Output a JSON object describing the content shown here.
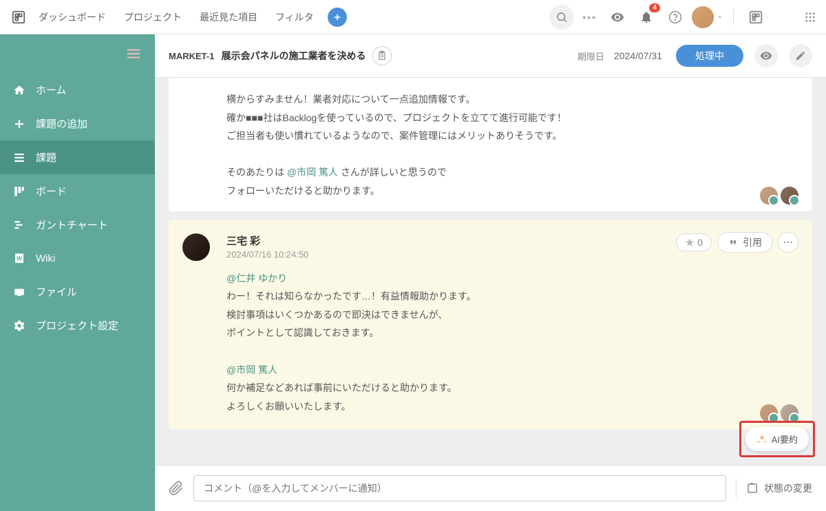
{
  "topnav": {
    "items": [
      "ダッシュボード",
      "プロジェクト",
      "最近見た項目",
      "フィルタ"
    ]
  },
  "notification_count": "4",
  "sidebar": {
    "items": [
      {
        "label": "ホーム"
      },
      {
        "label": "課題の追加"
      },
      {
        "label": "課題"
      },
      {
        "label": "ボード"
      },
      {
        "label": "ガントチャート"
      },
      {
        "label": "Wiki"
      },
      {
        "label": "ファイル"
      },
      {
        "label": "プロジェクト設定"
      }
    ]
  },
  "issue": {
    "key": "MARKET-1",
    "title": "展示会パネルの施工業者を決める",
    "due_label": "期限日",
    "due_date": "2024/07/31",
    "status": "処理中"
  },
  "comments": [
    {
      "line1": "横からすみません！業者対応について一点追加情報です。",
      "line2": "確か■■■社はBacklogを使っているので、プロジェクトを立てて進行可能です！",
      "line3": "ご担当者も使い慣れているようなので、案件管理にはメリットありそうです。",
      "line4a": "そのあたりは ",
      "mention1": "@市岡 篤人",
      "line4b": " さんが詳しいと思うので",
      "line5": "フォローいただけると助かります。"
    },
    {
      "author": "三宅 彩",
      "timestamp": "2024/07/16 10:24:50",
      "mention1": "@仁井 ゆかり",
      "line1": "わー！それは知らなかったです…！有益情報助かります。",
      "line2": "検討事項はいくつかあるので即決はできませんが、",
      "line3": "ポイントとして認識しておきます。",
      "mention2": "@市岡 篤人",
      "line4": "何か補足などあれば事前にいただけると助かります。",
      "line5": "よろしくお願いいたします。",
      "star_count": "0",
      "quote_label": "引用"
    }
  ],
  "input": {
    "placeholder": "コメント（@を入力してメンバーに通知）",
    "status_change": "状態の変更"
  },
  "ai_button": "AI要約"
}
